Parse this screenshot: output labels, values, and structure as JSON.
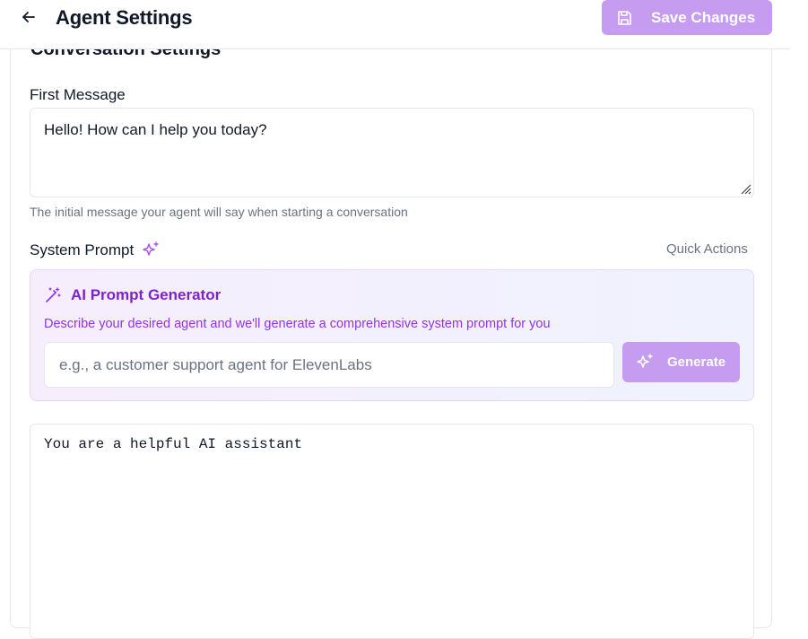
{
  "header": {
    "title": "Agent Settings",
    "save_label": "Save Changes"
  },
  "section": {
    "title": "Conversation Settings"
  },
  "first_message": {
    "label": "First Message",
    "value": "Hello! How can I help you today?",
    "help": "The initial message your agent will say when starting a conversation"
  },
  "system_prompt": {
    "label": "System Prompt",
    "quick_actions": "Quick Actions",
    "value": "You are a helpful AI assistant"
  },
  "generator": {
    "title": "AI Prompt Generator",
    "description": "Describe your desired agent and we'll generate a comprehensive system prompt for you",
    "placeholder": "e.g., a customer support agent for ElevenLabs",
    "button_label": "Generate"
  },
  "colors": {
    "accent": "#c69cf0",
    "accent_text": "#7e22ce",
    "muted": "#6b7280"
  }
}
